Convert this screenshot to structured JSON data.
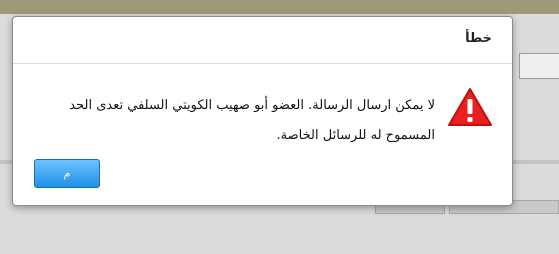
{
  "dialog": {
    "title": "خطأ",
    "message_line1": "لا يمكن ارسال الرسالة. العضو أبو صهيب الكويتي السلفي تعدى الحد",
    "message_line2": "المسموح له للرسائل الخاصة.",
    "ok_label": "م",
    "icon": "warning-triangle-icon"
  },
  "colors": {
    "warning": "#e8201f",
    "button": "#2d97ec",
    "top_bar": "#9c9a78"
  }
}
